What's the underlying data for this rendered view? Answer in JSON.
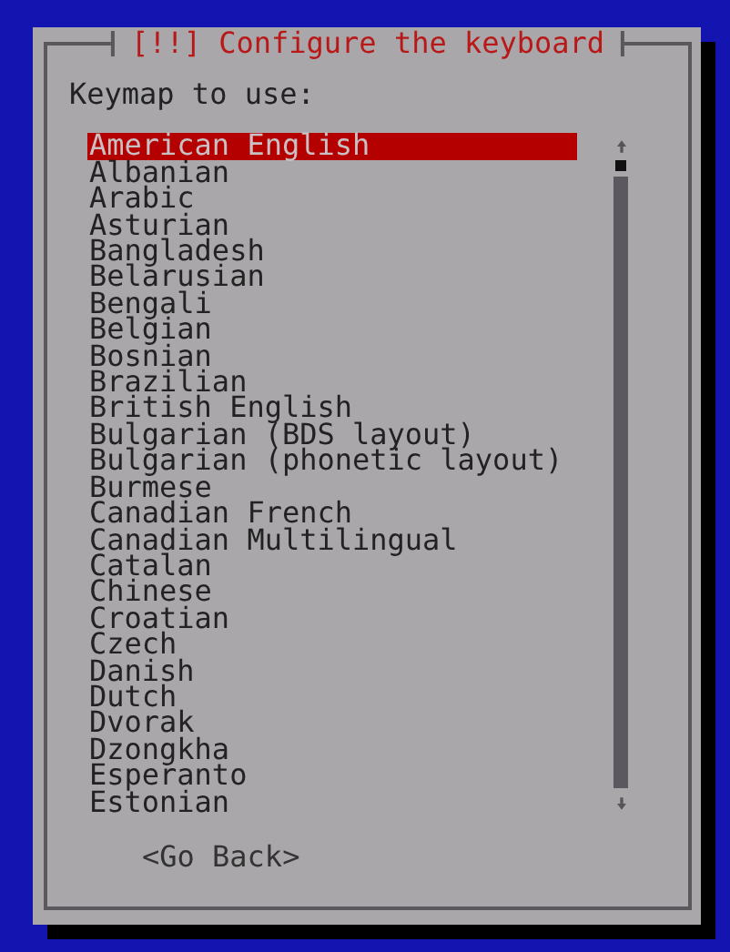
{
  "dialog": {
    "title": "[!!] Configure the keyboard",
    "prompt": "Keymap to use:",
    "items": [
      {
        "label": "American English",
        "selected": true
      },
      {
        "label": "Albanian",
        "selected": false
      },
      {
        "label": "Arabic",
        "selected": false
      },
      {
        "label": "Asturian",
        "selected": false
      },
      {
        "label": "Bangladesh",
        "selected": false
      },
      {
        "label": "Belarusian",
        "selected": false
      },
      {
        "label": "Bengali",
        "selected": false
      },
      {
        "label": "Belgian",
        "selected": false
      },
      {
        "label": "Bosnian",
        "selected": false
      },
      {
        "label": "Brazilian",
        "selected": false
      },
      {
        "label": "British English",
        "selected": false
      },
      {
        "label": "Bulgarian (BDS layout)",
        "selected": false
      },
      {
        "label": "Bulgarian (phonetic layout)",
        "selected": false
      },
      {
        "label": "Burmese",
        "selected": false
      },
      {
        "label": "Canadian French",
        "selected": false
      },
      {
        "label": "Canadian Multilingual",
        "selected": false
      },
      {
        "label": "Catalan",
        "selected": false
      },
      {
        "label": "Chinese",
        "selected": false
      },
      {
        "label": "Croatian",
        "selected": false
      },
      {
        "label": "Czech",
        "selected": false
      },
      {
        "label": "Danish",
        "selected": false
      },
      {
        "label": "Dutch",
        "selected": false
      },
      {
        "label": "Dvorak",
        "selected": false
      },
      {
        "label": "Dzongkha",
        "selected": false
      },
      {
        "label": "Esperanto",
        "selected": false
      },
      {
        "label": "Estonian",
        "selected": false
      }
    ],
    "buttons": [
      "<Go Back>"
    ]
  }
}
